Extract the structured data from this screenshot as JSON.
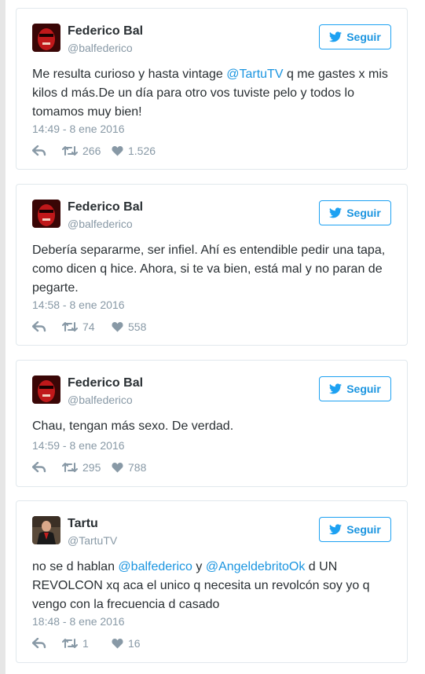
{
  "follow_label": "Seguir",
  "tweets": [
    {
      "name": "Federico Bal",
      "handle": "@balfederico",
      "text": [
        {
          "t": "Me resulta curioso y hasta vintage "
        },
        {
          "t": "@TartuTV",
          "mention": true
        },
        {
          "t": " q me gastes x mis kilos d más.De un día para otro vos tuviste pelo y todos lo tomamos muy bien!"
        }
      ],
      "date": "14:49 - 8 ene 2016",
      "retweets": "266",
      "likes": "1.526"
    },
    {
      "name": "Federico Bal",
      "handle": "@balfederico",
      "text": [
        {
          "t": "Debería separarme, ser infiel. Ahí es entendible pedir una tapa, como dicen q hice. Ahora, si te va bien, está mal y no paran de pegarte."
        }
      ],
      "date": "14:58 - 8 ene 2016",
      "retweets": "74",
      "likes": "558"
    },
    {
      "name": "Federico Bal",
      "handle": "@balfederico",
      "text": [
        {
          "t": "Chau, tengan más sexo. De verdad."
        }
      ],
      "date": "14:59 - 8 ene 2016",
      "retweets": "295",
      "likes": "788"
    },
    {
      "name": "Tartu",
      "handle": "@TartuTV",
      "text": [
        {
          "t": "no se d hablan "
        },
        {
          "t": "@balfederico",
          "mention": true
        },
        {
          "t": " y "
        },
        {
          "t": "@AngeldebritoOk",
          "mention": true
        },
        {
          "t": " d UN REVOLCON xq aca el unico q necesita un revolcón soy yo q vengo con la frecuencia d casado"
        }
      ],
      "date": "18:48 - 8 ene 2016",
      "retweets": "1",
      "likes": "16"
    }
  ],
  "colors": {
    "accent": "#1da1f2",
    "link": "#1b95e0",
    "muted": "#8899a6",
    "text": "#292f33",
    "border": "#e1e8ed"
  },
  "icons": [
    "reply-icon",
    "retweet-icon",
    "heart-icon",
    "twitter-bird-icon"
  ]
}
